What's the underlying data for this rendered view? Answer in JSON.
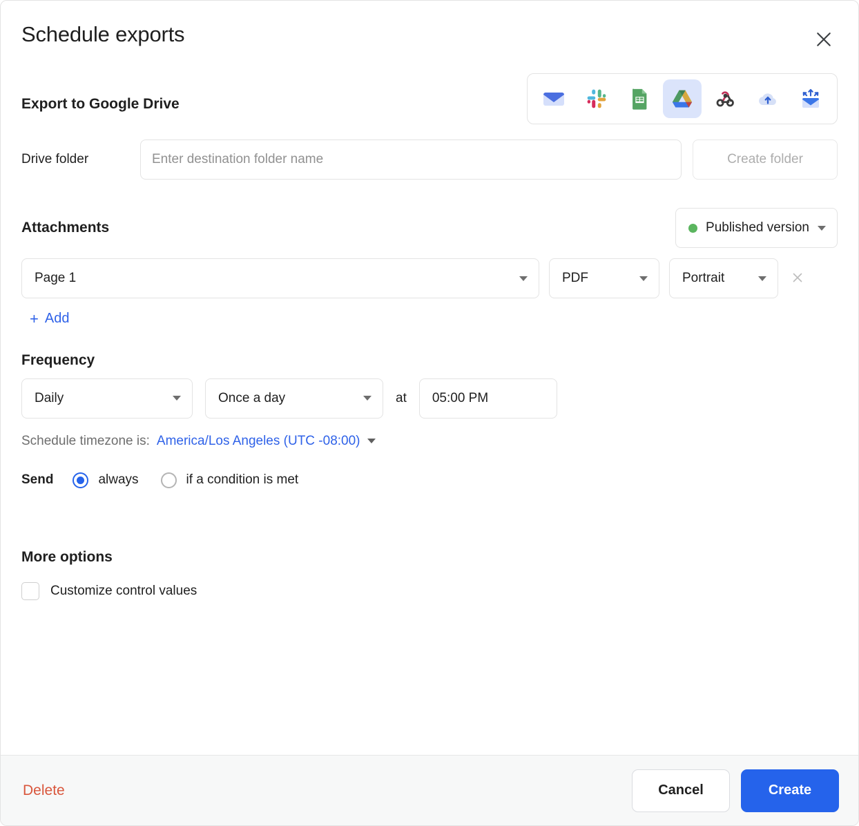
{
  "dialog": {
    "title": "Schedule exports",
    "close_icon": "close-icon"
  },
  "destinations": {
    "selected": "google-drive",
    "items": [
      {
        "id": "email",
        "icon": "email-envelope-icon",
        "label": "Email"
      },
      {
        "id": "slack",
        "icon": "slack-icon",
        "label": "Slack"
      },
      {
        "id": "google-sheets",
        "icon": "google-sheets-icon",
        "label": "Google Sheets"
      },
      {
        "id": "google-drive",
        "icon": "google-drive-icon",
        "label": "Google Drive"
      },
      {
        "id": "webhook",
        "icon": "webhook-icon",
        "label": "Webhook"
      },
      {
        "id": "s3",
        "icon": "cloud-upload-icon",
        "label": "Amazon S3"
      },
      {
        "id": "sftp",
        "icon": "sftp-envelope-icon",
        "label": "SFTP"
      }
    ]
  },
  "export": {
    "heading": "Export to Google Drive",
    "folder_label": "Drive folder",
    "folder_value": "",
    "folder_placeholder": "Enter destination folder name",
    "create_folder_label": "Create folder"
  },
  "attachments": {
    "heading": "Attachments",
    "version": {
      "label": "Published version",
      "dot_color": "#5bb55f"
    },
    "rows": [
      {
        "page": "Page 1",
        "format": "PDF",
        "orientation": "Portrait",
        "remove_icon": "remove-x-icon"
      }
    ],
    "add_label": "Add",
    "add_plus": "+"
  },
  "frequency": {
    "heading": "Frequency",
    "interval": "Daily",
    "cadence": "Once a day",
    "at_label": "at",
    "time": "05:00 PM",
    "timezone_prefix": "Schedule timezone is:",
    "timezone_value": "America/Los Angeles (UTC -08:00)"
  },
  "send": {
    "label": "Send",
    "options": [
      {
        "label": "always",
        "checked": true
      },
      {
        "label": "if a condition is met",
        "checked": false
      }
    ]
  },
  "more_options": {
    "heading": "More options",
    "checkbox_label": "Customize control values",
    "checked": false
  },
  "footer": {
    "delete_label": "Delete",
    "cancel_label": "Cancel",
    "create_label": "Create"
  },
  "colors": {
    "accent": "#2563eb",
    "link": "#2f62e8",
    "danger": "#d9563c",
    "status_green": "#5bb55f"
  }
}
